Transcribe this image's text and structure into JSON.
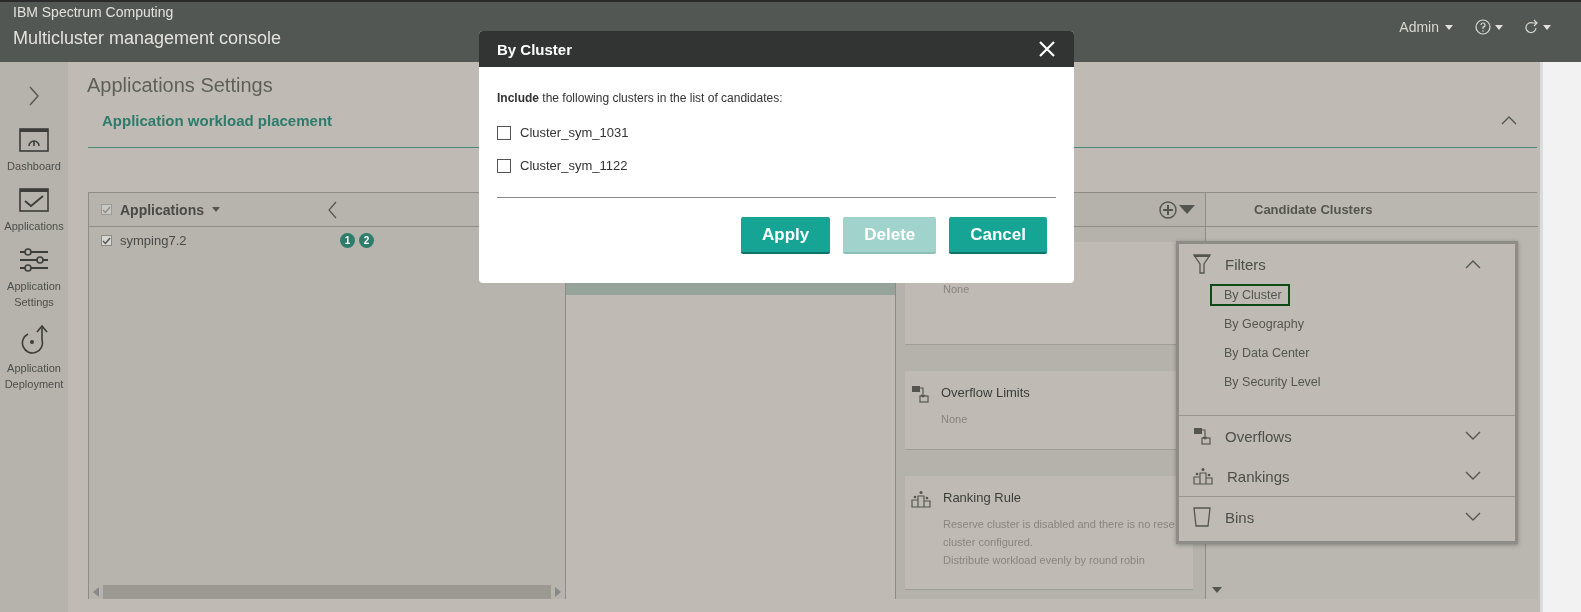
{
  "header": {
    "brand": "IBM Spectrum Computing",
    "title": "Multicluster management console",
    "user": "Admin"
  },
  "sidebar": {
    "items": [
      {
        "kind": "dashboard",
        "label": "Dashboard"
      },
      {
        "kind": "applications",
        "label": "Applications"
      },
      {
        "kind": "settings",
        "label": "Application Settings"
      },
      {
        "kind": "deployment",
        "label": "Application Deployment"
      }
    ]
  },
  "page": {
    "title": "Applications Settings",
    "section": "Application workload placement",
    "expanded": true
  },
  "applications": {
    "title": "Applications",
    "all_checked": true,
    "rows": [
      {
        "name": "symping7.2",
        "checked": true,
        "badges": [
          "1",
          "2"
        ]
      }
    ]
  },
  "bins": [
    {
      "selected": true
    }
  ],
  "rules": [
    {
      "lines": [
        "None"
      ]
    },
    {
      "kind": "overflow",
      "title": "Overflow Limits",
      "lines": [
        "None"
      ]
    },
    {
      "kind": "ranking",
      "title": "Ranking Rule",
      "lines": [
        "Reserve cluster is disabled and there is no rese",
        "cluster configured.",
        "Distribute workload evenly by round robin"
      ]
    }
  ],
  "candidates": {
    "title": "Candidate Clusters"
  },
  "menu": [
    {
      "kind": "filter",
      "label": "Filters",
      "expanded": true,
      "items": [
        {
          "label": "By Cluster",
          "selected": true
        },
        {
          "label": "By Geography",
          "selected": false
        },
        {
          "label": "By Data Center",
          "selected": false
        },
        {
          "label": "By Security Level",
          "selected": false
        }
      ]
    },
    {
      "kind": "overflow",
      "label": "Overflows",
      "expanded": false
    },
    {
      "kind": "ranking",
      "label": "Rankings",
      "expanded": false
    },
    {
      "kind": "bin",
      "label": "Bins",
      "expanded": false
    }
  ],
  "dialog": {
    "title": "By Cluster",
    "intro": "**Include** the following clusters in the list of candidates:",
    "clusters": [
      {
        "label": "Cluster_sym_1031",
        "checked": false
      },
      {
        "label": "Cluster_sym_1122",
        "checked": false
      }
    ],
    "buttons": [
      {
        "label": "Apply",
        "disabled": false
      },
      {
        "label": "Delete",
        "disabled": true
      },
      {
        "label": "Cancel",
        "disabled": false
      }
    ]
  }
}
